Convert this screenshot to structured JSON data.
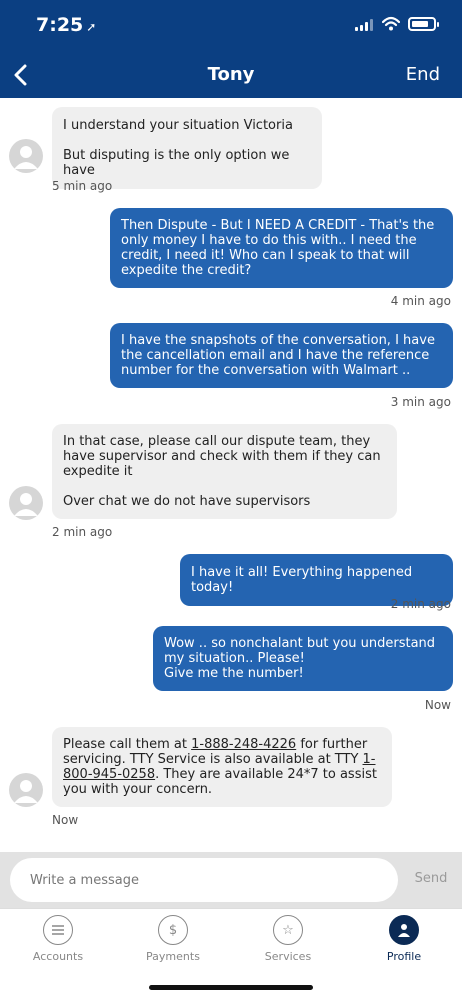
{
  "status": {
    "time": "7:25"
  },
  "header": {
    "title": "Tony",
    "end_label": "End"
  },
  "messages": {
    "m1": {
      "lines": "I understand your situation Victoria\n\nBut disputing is the only option we have",
      "time": "5 min ago"
    },
    "m2": {
      "lines": "Then Dispute - But I NEED A CREDIT - That's the only money I have to do this with.. I need the credit, I need it! Who can I speak to that will expedite the credit?",
      "time": "4 min ago"
    },
    "m3": {
      "lines": "I have the snapshots of the conversation, I have the cancellation email and I have the reference number for the conversation with Walmart ..",
      "time": "3 min ago"
    },
    "m4": {
      "lines": "In that case, please call our dispute team, they have supervisor and check with them if they can expedite it\n\nOver chat we do not have supervisors",
      "time": "2 min ago"
    },
    "m5": {
      "lines": "I have it all! Everything happened today!",
      "time": "2 min ago"
    },
    "m6": {
      "lines": "Wow .. so nonchalant but you understand my situation.. Please!\nGive me the number!",
      "time": "Now"
    },
    "m7": {
      "part1": "Please call them at ",
      "phone1": "1-888-248-4226",
      "part2": " for further servicing. TTY Service is also available at TTY ",
      "phone2": "1-800-945-0258",
      "part3": ". They are available 24*7 to assist you with your concern.",
      "time": "Now"
    }
  },
  "composer": {
    "placeholder": "Write a message",
    "send_label": "Send"
  },
  "tabs": [
    {
      "label": "Accounts",
      "icon": "list-icon"
    },
    {
      "label": "Payments",
      "icon": "dollar-transfer-icon"
    },
    {
      "label": "Services",
      "icon": "star-icon"
    },
    {
      "label": "Profile",
      "icon": "person-icon"
    }
  ],
  "colors": {
    "header": "#0b3f82",
    "outgoing_bubble": "#2464b1",
    "incoming_bubble": "#efefef"
  }
}
